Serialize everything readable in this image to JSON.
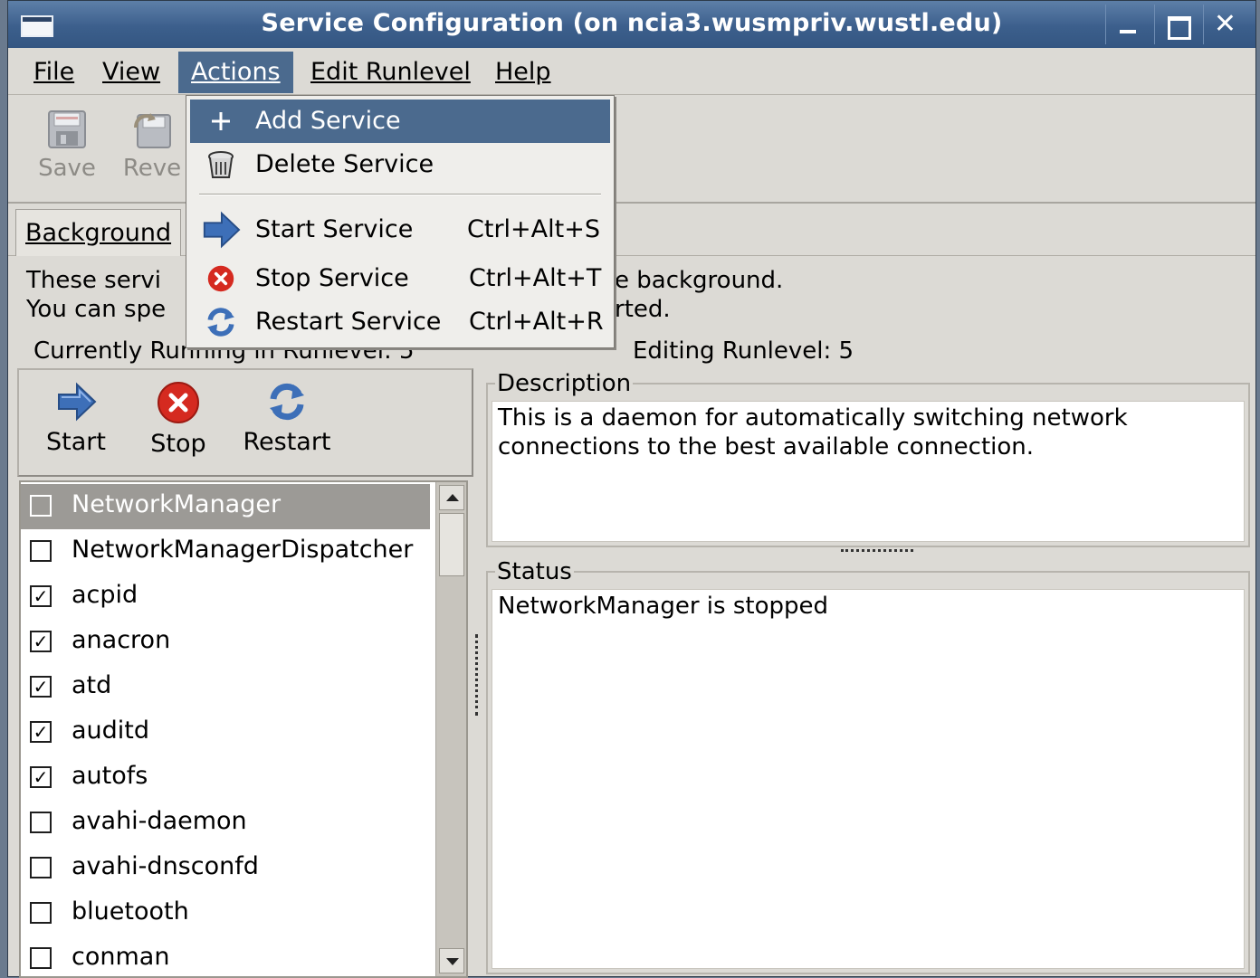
{
  "window": {
    "title": "Service Configuration (on ncia3.wusmpriv.wustl.edu)",
    "close_glyph": "✕"
  },
  "menubar": {
    "file": "File",
    "view": "View",
    "actions": "Actions",
    "edit_runlevel": "Edit Runlevel",
    "help": "Help"
  },
  "toolbar": {
    "save_label": "Save",
    "revert_label": "Reve"
  },
  "tabs": {
    "background": "Background"
  },
  "info": {
    "line1_start": "These servi",
    "line1_end": "e background.",
    "line2_start": "You can spe",
    "line2_end": "rted.",
    "running_label": "Currently Running in Runlevel: 5",
    "editing_label": "Editing Runlevel: 5"
  },
  "service_toolbar": {
    "start_label": "Start",
    "stop_label": "Stop",
    "restart_label": "Restart"
  },
  "services": [
    {
      "name": "NetworkManager",
      "checked": false,
      "selected": true
    },
    {
      "name": "NetworkManagerDispatcher",
      "checked": false,
      "selected": false
    },
    {
      "name": "acpid",
      "checked": true,
      "selected": false
    },
    {
      "name": "anacron",
      "checked": true,
      "selected": false
    },
    {
      "name": "atd",
      "checked": true,
      "selected": false
    },
    {
      "name": "auditd",
      "checked": true,
      "selected": false
    },
    {
      "name": "autofs",
      "checked": true,
      "selected": false
    },
    {
      "name": "avahi-daemon",
      "checked": false,
      "selected": false
    },
    {
      "name": "avahi-dnsconfd",
      "checked": false,
      "selected": false
    },
    {
      "name": "bluetooth",
      "checked": false,
      "selected": false
    },
    {
      "name": "conman",
      "checked": false,
      "selected": false
    }
  ],
  "description": {
    "caption": "Description",
    "text": "This is a daemon for automatically switching network connections to the best available connection."
  },
  "status": {
    "caption": "Status",
    "text": "NetworkManager is stopped"
  },
  "actions_menu": {
    "add_service": "Add Service",
    "delete_service": "Delete Service",
    "start_service": "Start Service",
    "start_shortcut": "Ctrl+Alt+S",
    "stop_service": "Stop Service",
    "stop_shortcut": "Ctrl+Alt+T",
    "restart_service": "Restart Service",
    "restart_shortcut": "Ctrl+Alt+R"
  },
  "icons": {
    "start": "blue-arrow-right-icon",
    "stop": "red-circle-x-icon",
    "restart": "blue-refresh-icon",
    "add": "plus-icon",
    "delete": "trash-can-icon",
    "save": "floppy-disk-icon",
    "revert": "revert-icon"
  },
  "colors": {
    "title_bar": "#3c5f8c",
    "menu_highlight": "#4b6a8e",
    "selection": "#9c9a96",
    "window_bg": "#dcdad5",
    "stop_red": "#d52a20",
    "start_blue": "#3d6fb8"
  }
}
